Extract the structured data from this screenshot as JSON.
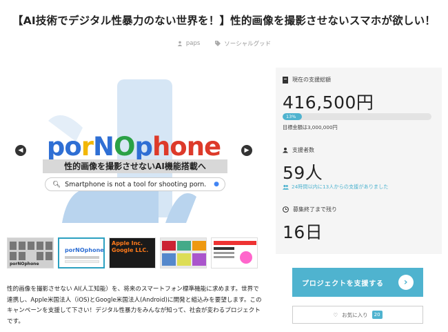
{
  "title": "【AI技術でデジタル性暴力のない世界を！】性的画像を撮影させないスマホが欲しい！",
  "meta": {
    "author": "paps",
    "category": "ソーシャルグッド"
  },
  "hero": {
    "logo_parts": [
      "po",
      "r",
      "NO",
      "phone"
    ],
    "banner": "性的画像を撮影させないAI機能搭載へ",
    "search_text": "Smartphone is not a tool for shooting porn."
  },
  "thumbnails": [
    {
      "label": "porNOphone",
      "selected": false
    },
    {
      "label": "porNOphone",
      "selected": true
    },
    {
      "label": "Apple Inc. Google LLC.",
      "selected": false
    },
    {
      "label": "",
      "selected": false
    },
    {
      "label": "",
      "selected": false
    }
  ],
  "description": "性的画像を撮影させない AI(人工知能）を、将来のスマートフォン標準機能に求めます。世界で連携し、Apple米国法人（iOS)とGoogle米国法人(Android)に開発と組込みを要望します。このキャンペーンを支援して下さい！デジタル性暴力をみんなが知って、社会が変わるプロジェクトです。",
  "stats": {
    "total_label": "現在の支援総額",
    "total_value": "416,500円",
    "progress_pct": 13,
    "progress_label": "13%",
    "goal_text": "目標金額は3,000,000円",
    "supporters_label": "支援者数",
    "supporters_value": "59人",
    "recent_text": "24時間以内に13人からの支援がありました",
    "remaining_label": "募集終了まで残り",
    "remaining_value": "16日"
  },
  "cta": {
    "label": "プロジェクトを支援する"
  },
  "favorite": {
    "label": "お気に入り",
    "count": "20"
  },
  "colors": {
    "accent": "#4fb3cf",
    "progress_bg": "#e3e3e3"
  }
}
